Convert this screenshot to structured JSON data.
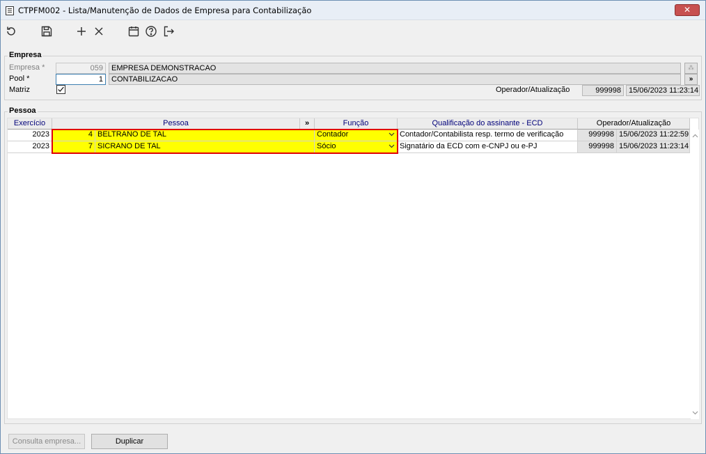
{
  "window": {
    "title": "CTPFM002 - Lista/Manutenção de Dados de Empresa para Contabilização",
    "close_label": "✕"
  },
  "toolbar": {
    "buttons": [
      "refresh-icon",
      "save-icon",
      "add-icon",
      "delete-icon",
      "calendar-icon",
      "help-icon",
      "exit-icon"
    ]
  },
  "empresa": {
    "legend": "Empresa",
    "empresa_label": "Empresa *",
    "empresa_code": "059",
    "empresa_name": "EMPRESA DEMONSTRACAO",
    "pool_label": "Pool *",
    "pool_code": "1",
    "pool_name": "CONTABILIZACAO",
    "pool_btn": "»",
    "matriz_label": "Matriz",
    "matriz_checked": true,
    "operador_label": "Operador/Atualização",
    "operador": "999998",
    "atualizacao": "15/06/2023 11:23:14"
  },
  "pessoa": {
    "legend": "Pessoa",
    "columns": {
      "exercicio": "Exercício",
      "pessoa": "Pessoa",
      "expand": "»",
      "funcao": "Função",
      "qualificacao": "Qualificação do assinante - ECD",
      "operador": "Operador/Atualização"
    },
    "rows": [
      {
        "exercicio": "2023",
        "codigo": "4",
        "nome": "BELTRANO DE TAL",
        "funcao": "Contador",
        "qualificacao": "Contador/Contabilista resp. termo de verificação",
        "operador": "999998",
        "atualizacao": "15/06/2023 11:22:59"
      },
      {
        "exercicio": "2023",
        "codigo": "7",
        "nome": "SICRANO DE TAL",
        "funcao": "Sócio",
        "qualificacao": "Signatário da ECD com e-CNPJ ou e-PJ",
        "operador": "999998",
        "atualizacao": "15/06/2023 11:23:14"
      }
    ]
  },
  "footer": {
    "consulta_label": "Consulta empresa...",
    "duplicar_label": "Duplicar"
  },
  "colors": {
    "highlight": "#ffff00",
    "frame": "#e00000",
    "header_text": "#00007a"
  }
}
